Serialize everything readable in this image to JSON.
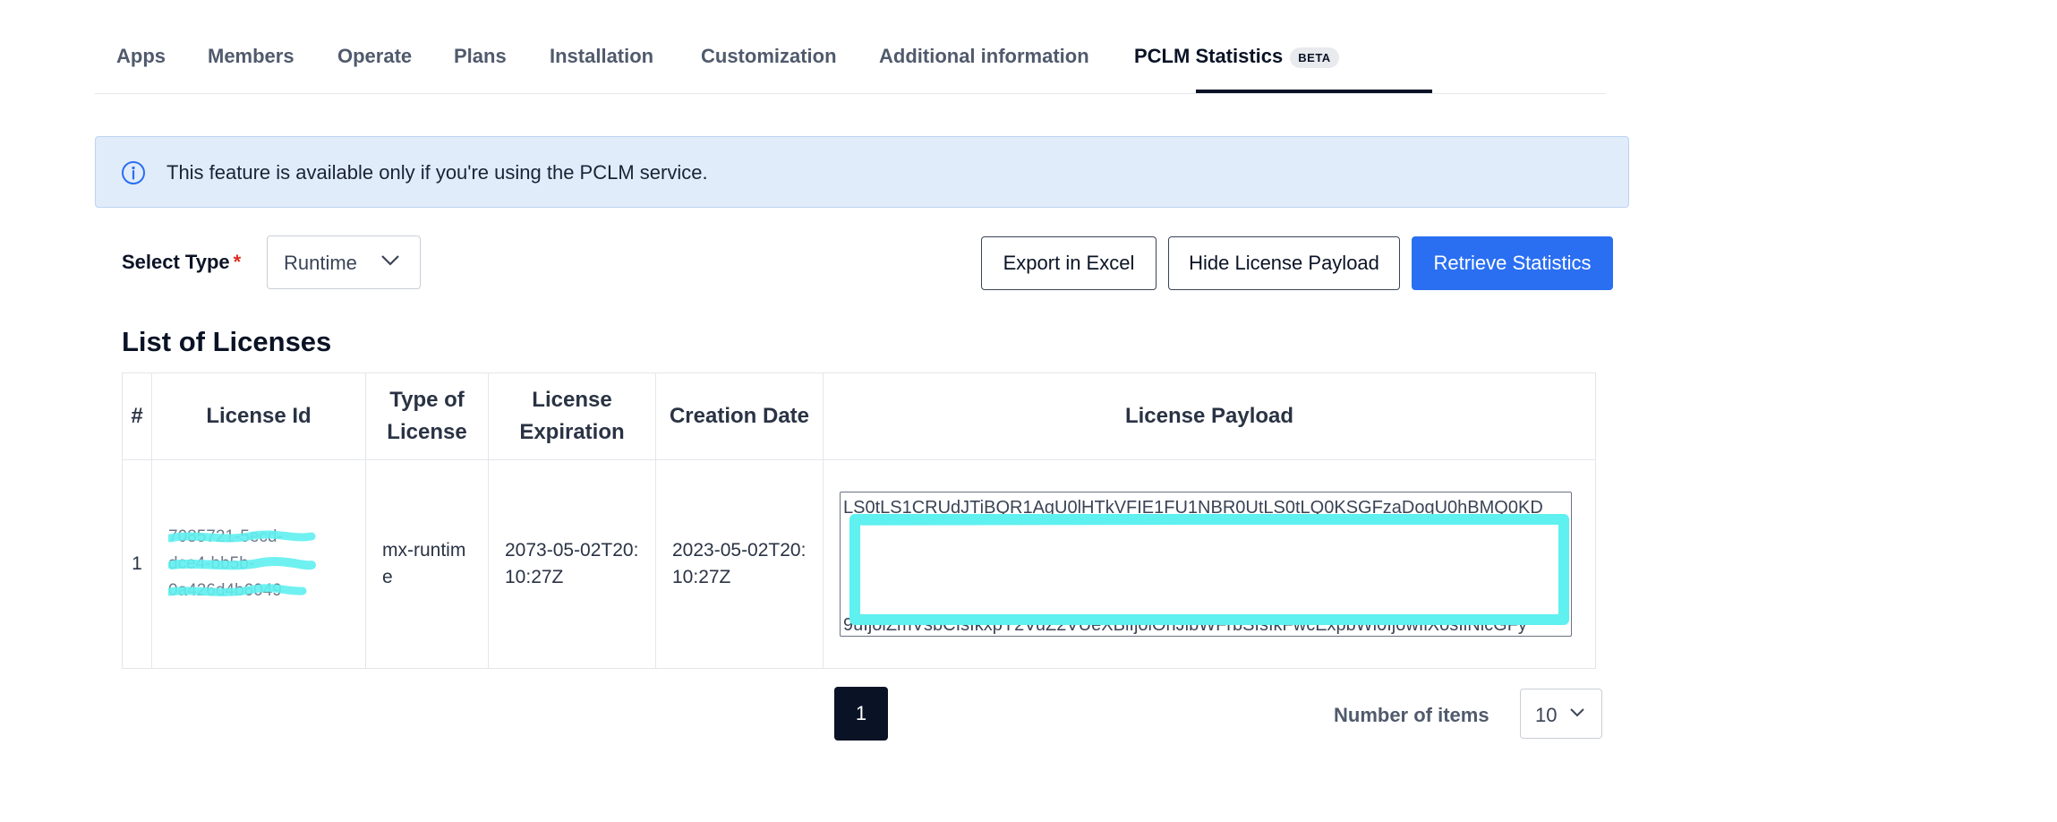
{
  "tabs": [
    {
      "label": "Apps"
    },
    {
      "label": "Members"
    },
    {
      "label": "Operate"
    },
    {
      "label": "Plans"
    },
    {
      "label": "Installation"
    },
    {
      "label": "Customization"
    },
    {
      "label": "Additional information"
    },
    {
      "label": "PCLM Statistics",
      "badge": "BETA",
      "active": true
    }
  ],
  "banner": {
    "icon": "info-icon",
    "text": "This feature is available only if you're using the PCLM service."
  },
  "controls": {
    "select_type_label": "Select Type",
    "required_mark": "*",
    "select_type_value": "Runtime",
    "export_label": "Export in Excel",
    "hide_payload_label": "Hide License Payload",
    "retrieve_label": "Retrieve Statistics"
  },
  "licenses": {
    "title": "List of Licenses",
    "columns": [
      "#",
      "License Id",
      "Type of License",
      "License Expiration",
      "Creation Date",
      "License Payload"
    ],
    "rows": [
      {
        "index": "1",
        "license_id_lines": [
          "7085721-5ecd-",
          "dce4-bb5b-",
          "0a426d4b6049"
        ],
        "type": "mx-runtime",
        "expiration": "2073-05-02T20:10:27Z",
        "creation": "2023-05-02T20:10:27Z",
        "payload_first_line": "LS0tLS1CRUdJTiBQR1AgU0lHTkVFIE1FU1NBR0UtLS0tLQ0KSGFzaDogU0hBMQ0KD",
        "payload_last_line": "9uIjoiZmVsbCIsIkxpY2VuZ2VUeXBlIjoiOhJlbWFrbSIsIkFwcExpbWl0IjowIiXosIlNlcGFy"
      }
    ]
  },
  "pagination": {
    "current_page": "1",
    "items_label": "Number of items",
    "items_value": "10"
  },
  "colors": {
    "primary": "#2a6ff2",
    "dark": "#0a1325",
    "banner_bg": "#e1ecfa",
    "redaction": "#5ff0f0"
  }
}
